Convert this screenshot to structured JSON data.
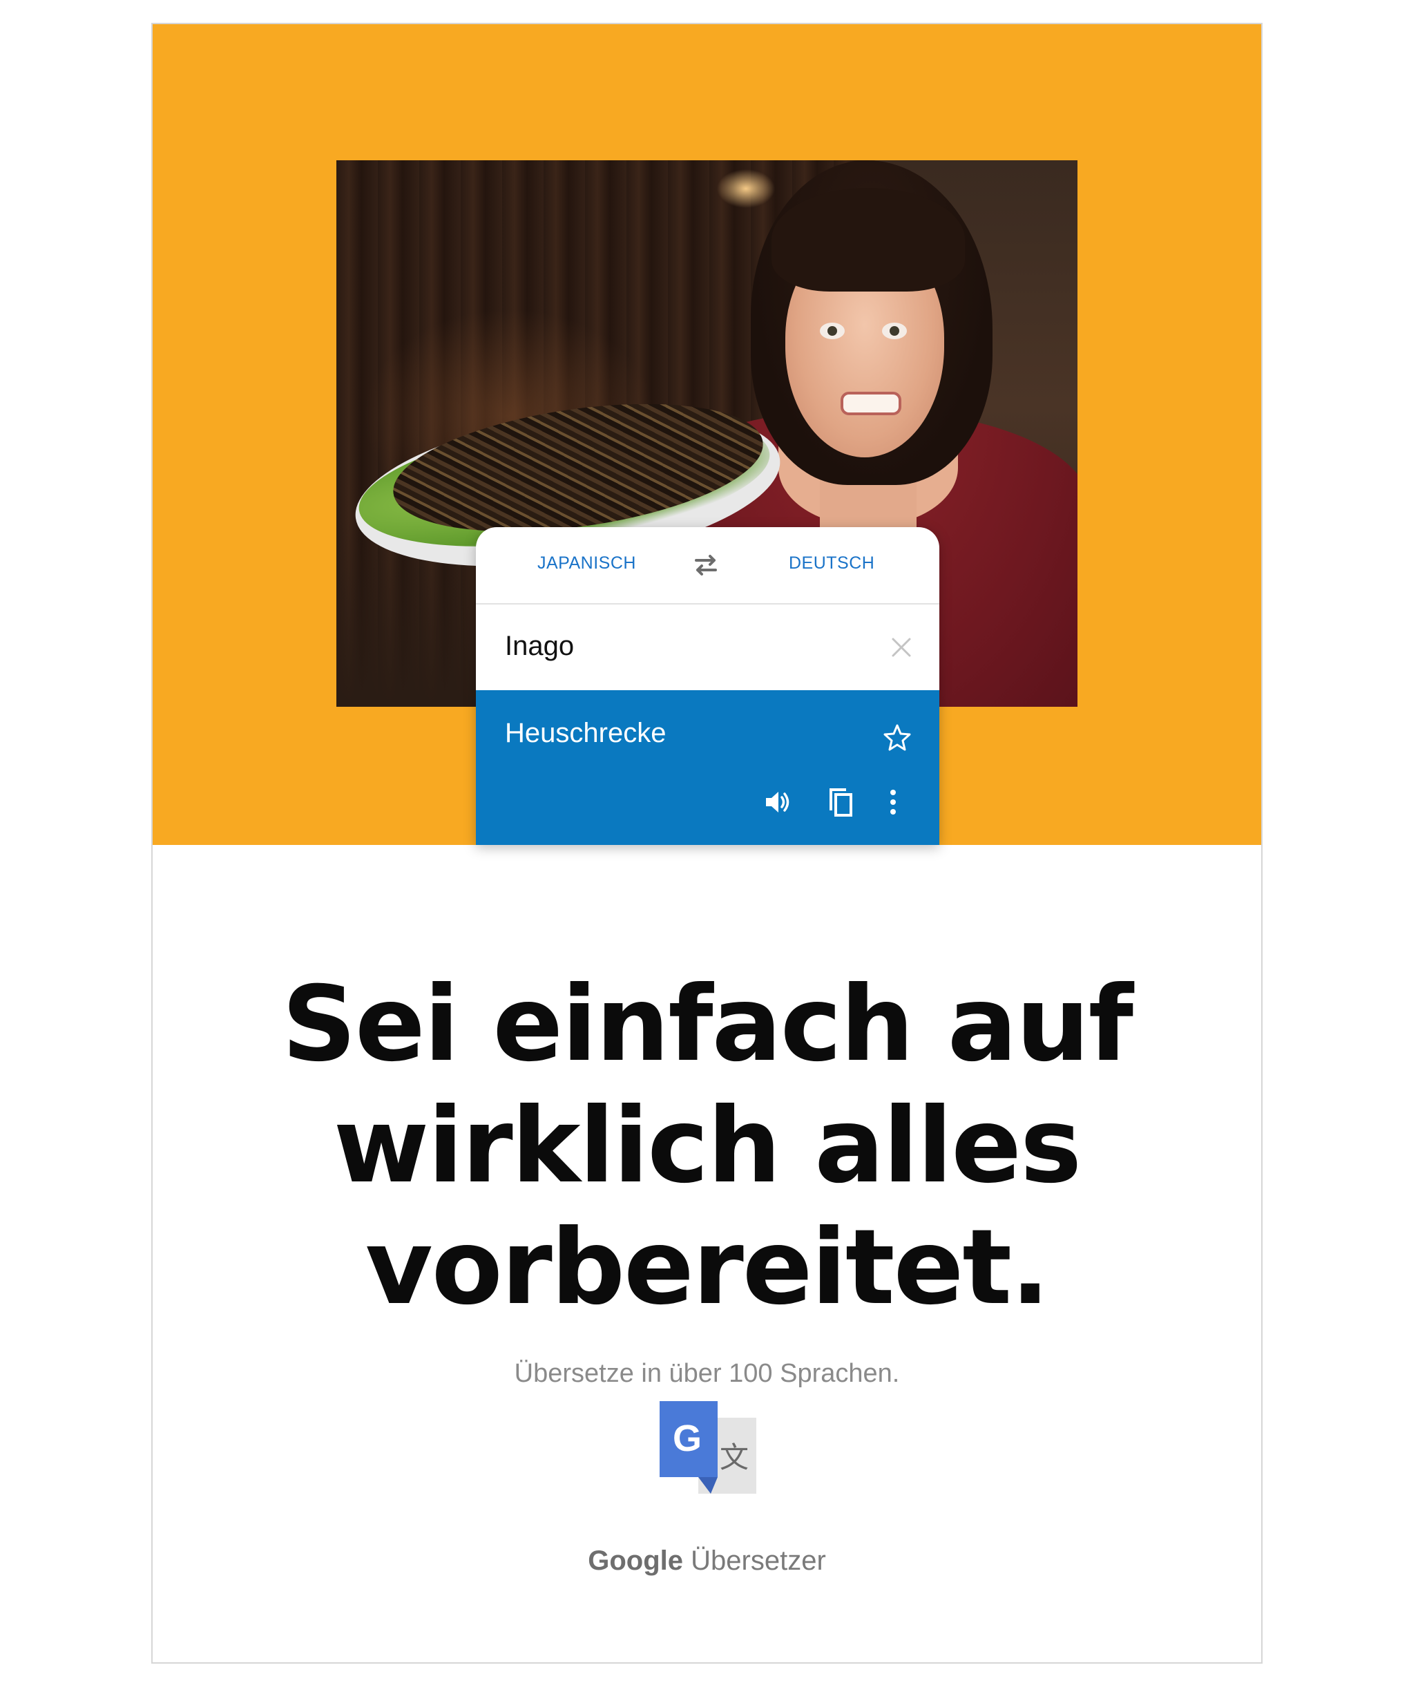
{
  "translator": {
    "source_language": "JAPANISCH",
    "target_language": "DEUTSCH",
    "input_text": "Inago",
    "translation": "Heuschrecke"
  },
  "headline": {
    "line1": "Sei einfach auf",
    "line2": "wirklich alles",
    "line3": "vorbereitet."
  },
  "subline": "Übersetze in über 100 Sprachen.",
  "brand": {
    "google": "Google",
    "product": "Übersetzer",
    "logo_letters": [
      "G",
      "文"
    ]
  },
  "colors": {
    "orange_band": "#f8a922",
    "translate_blue": "#0a79c0",
    "language_label_blue": "#1a73c8",
    "headline": "#0b0b0b",
    "subline_gray": "#8a8a8a"
  },
  "icons": [
    "swap-icon",
    "clear-icon",
    "star-icon",
    "speaker-icon",
    "copy-icon",
    "more-icon",
    "google-translate-logo-icon"
  ]
}
